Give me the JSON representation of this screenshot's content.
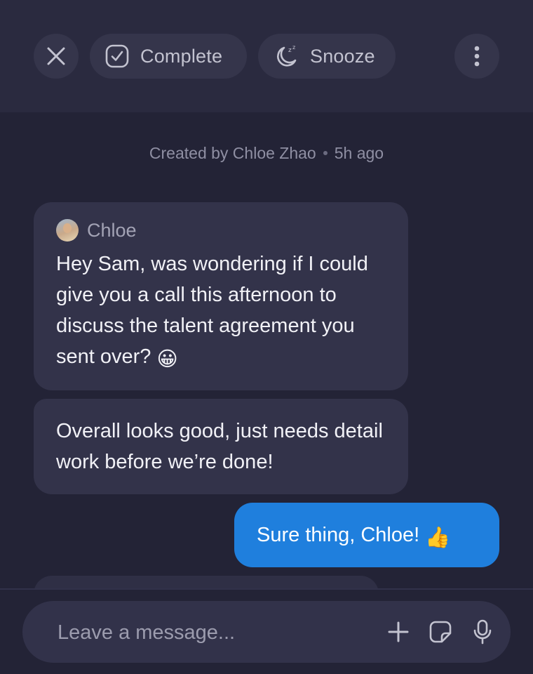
{
  "toolbar": {
    "close_icon": "close-icon",
    "complete_label": "Complete",
    "complete_icon": "checkbox-check-icon",
    "snooze_label": "Snooze",
    "snooze_icon": "moon-zz-icon",
    "more_icon": "vertical-dots-icon"
  },
  "meta": {
    "created_by": "Created by Chloe Zhao",
    "time_ago": "5h ago"
  },
  "messages": [
    {
      "sender": "Chloe",
      "text": "Hey Sam, was wondering if I could give you a call this afternoon to discuss the talent agreement you sent over?",
      "emoji": "😀"
    },
    {
      "text": "Overall looks good, just needs detail work before we’re done!"
    },
    {
      "text": "Sure thing, Chloe!",
      "emoji": "👍"
    }
  ],
  "composer": {
    "placeholder": "Leave a message...",
    "value": "",
    "icons": [
      "plus-icon",
      "sticker-icon",
      "microphone-icon"
    ]
  },
  "colors": {
    "background": "#232336",
    "toolbar": "#2a2a3f",
    "pill": "#35354b",
    "incoming_bubble": "#33334a",
    "outgoing_bubble": "#1f7fdd"
  }
}
